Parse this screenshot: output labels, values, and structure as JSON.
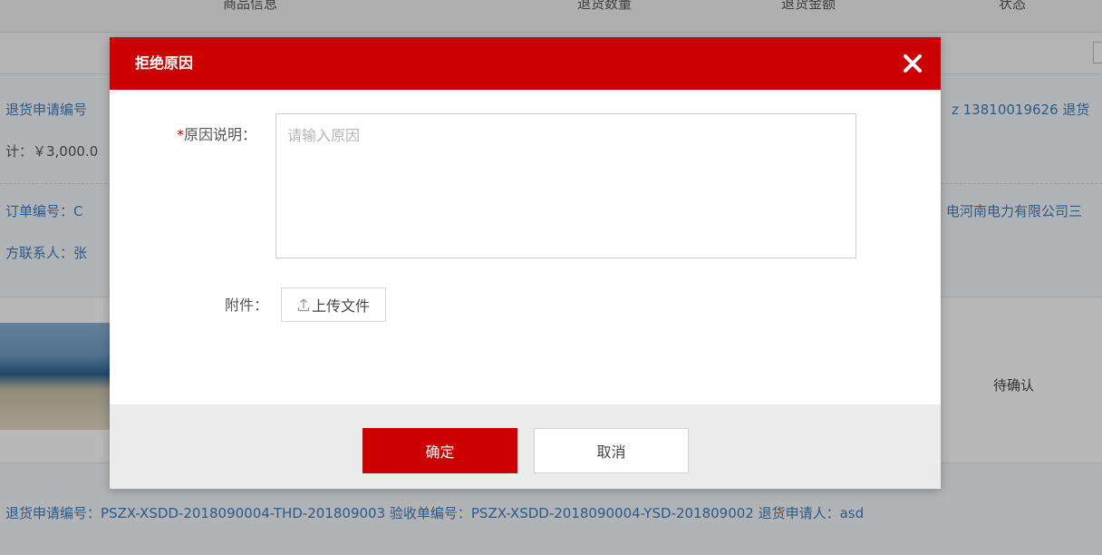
{
  "background": {
    "header_cols": [
      "商品信息",
      "退货数量",
      "退货金额",
      "状态"
    ],
    "line1_left": "退货申请编号",
    "line1_right": "z 13810019626   退货",
    "line2_left": "计：￥3,000.0",
    "line3_left": "订单编号：C",
    "line3_right": "电河南电力有限公司三",
    "line4_left": "方联系人：张",
    "status": "待确认",
    "bottom_line": "退货申请编号：PSZX-XSDD-2018090004-THD-201809003   验收单编号：PSZX-XSDD-2018090004-YSD-201809002   退货申请人：asd"
  },
  "dialog": {
    "title": "拒绝原因",
    "required_mark": "*",
    "reason_label": "原因说明：",
    "reason_placeholder": "请输入原因",
    "reason_value": "",
    "attachment_label": "附件：",
    "upload_label": "上传文件",
    "confirm_label": "确定",
    "cancel_label": "取消"
  },
  "colors": {
    "accent": "#cc0000",
    "link_blue": "#3a7ec2"
  },
  "icons": {
    "close": "close-icon",
    "upload": "upload-icon"
  }
}
